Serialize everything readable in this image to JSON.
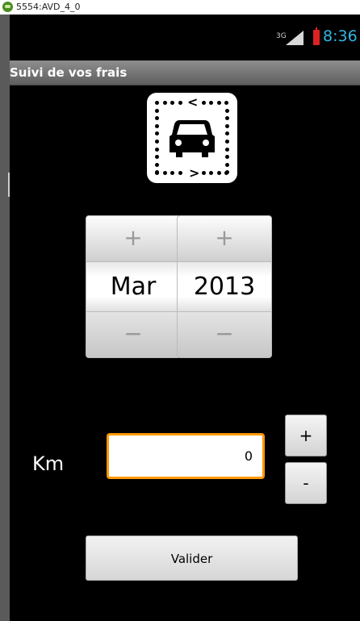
{
  "window": {
    "title": "5554:AVD_4_0"
  },
  "statusbar": {
    "network": "3G",
    "time": "8:36"
  },
  "actionbar": {
    "title": "Suivi de vos frais"
  },
  "logo": {
    "icon": "car-icon",
    "arrow_left": "<",
    "arrow_right": ">"
  },
  "date_picker": {
    "month": {
      "plus": "+",
      "value": "Mar",
      "minus": "−"
    },
    "year": {
      "plus": "+",
      "value": "2013",
      "minus": "−"
    }
  },
  "km": {
    "label": "Km",
    "value": "0",
    "plus": "+",
    "minus": "-"
  },
  "validate": {
    "label": "Valider"
  },
  "colors": {
    "accent": "#ff9900",
    "clock": "#33b5e5",
    "battery": "#dd2222"
  }
}
